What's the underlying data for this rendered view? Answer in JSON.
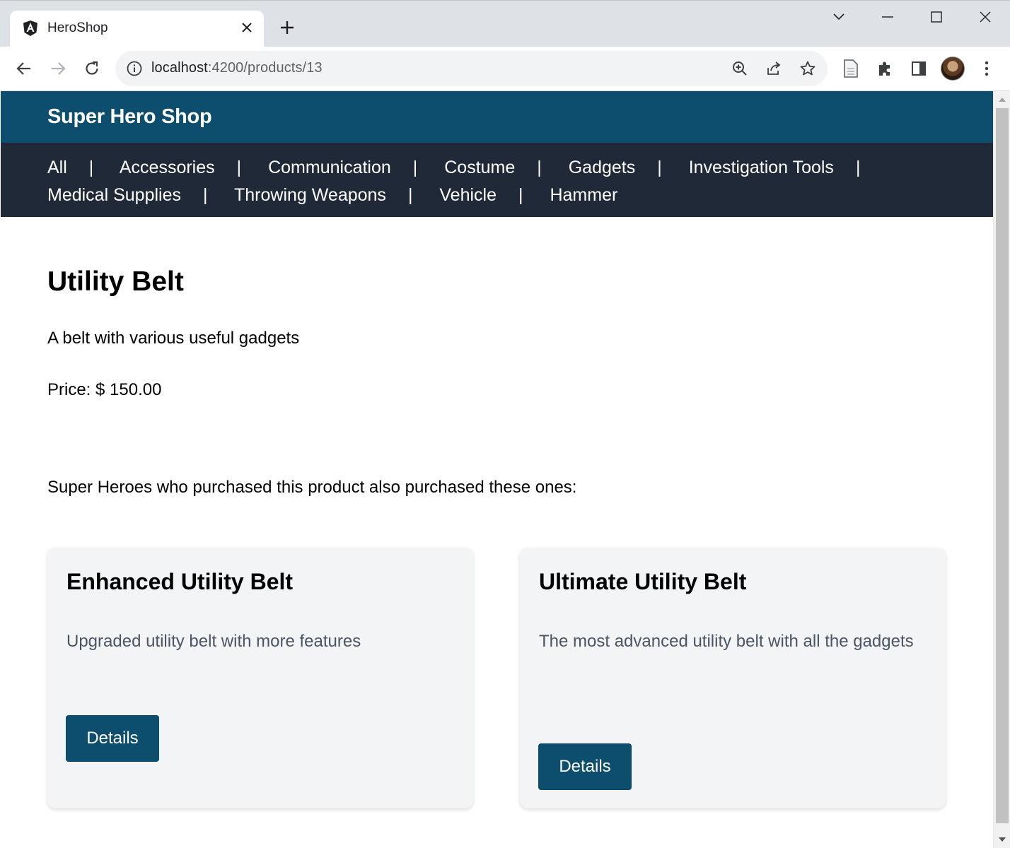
{
  "browser": {
    "tab_title": "HeroShop",
    "url_host": "localhost",
    "url_path": ":4200/products/13"
  },
  "header": {
    "brand": "Super Hero Shop"
  },
  "nav": {
    "categories": [
      "All",
      "Accessories",
      "Communication",
      "Costume",
      "Gadgets",
      "Investigation Tools",
      "Medical Supplies",
      "Throwing Weapons",
      "Vehicle",
      "Hammer"
    ],
    "separator": "|"
  },
  "product": {
    "title": "Utility Belt",
    "description": "A belt with various useful gadgets",
    "price": "Price: $ 150.00"
  },
  "related": {
    "heading": "Super Heroes who purchased this product also purchased these ones:",
    "cards": [
      {
        "title": "Enhanced Utility Belt",
        "description": "Upgraded utility belt with more features",
        "button": "Details"
      },
      {
        "title": "Ultimate Utility Belt",
        "description": "The most advanced utility belt with all the gadgets",
        "button": "Details"
      }
    ]
  },
  "colors": {
    "brand_bar": "#0d4d6d",
    "nav_bar": "#1f2937",
    "card_bg": "#f3f4f6",
    "button": "#0d4d6d"
  }
}
